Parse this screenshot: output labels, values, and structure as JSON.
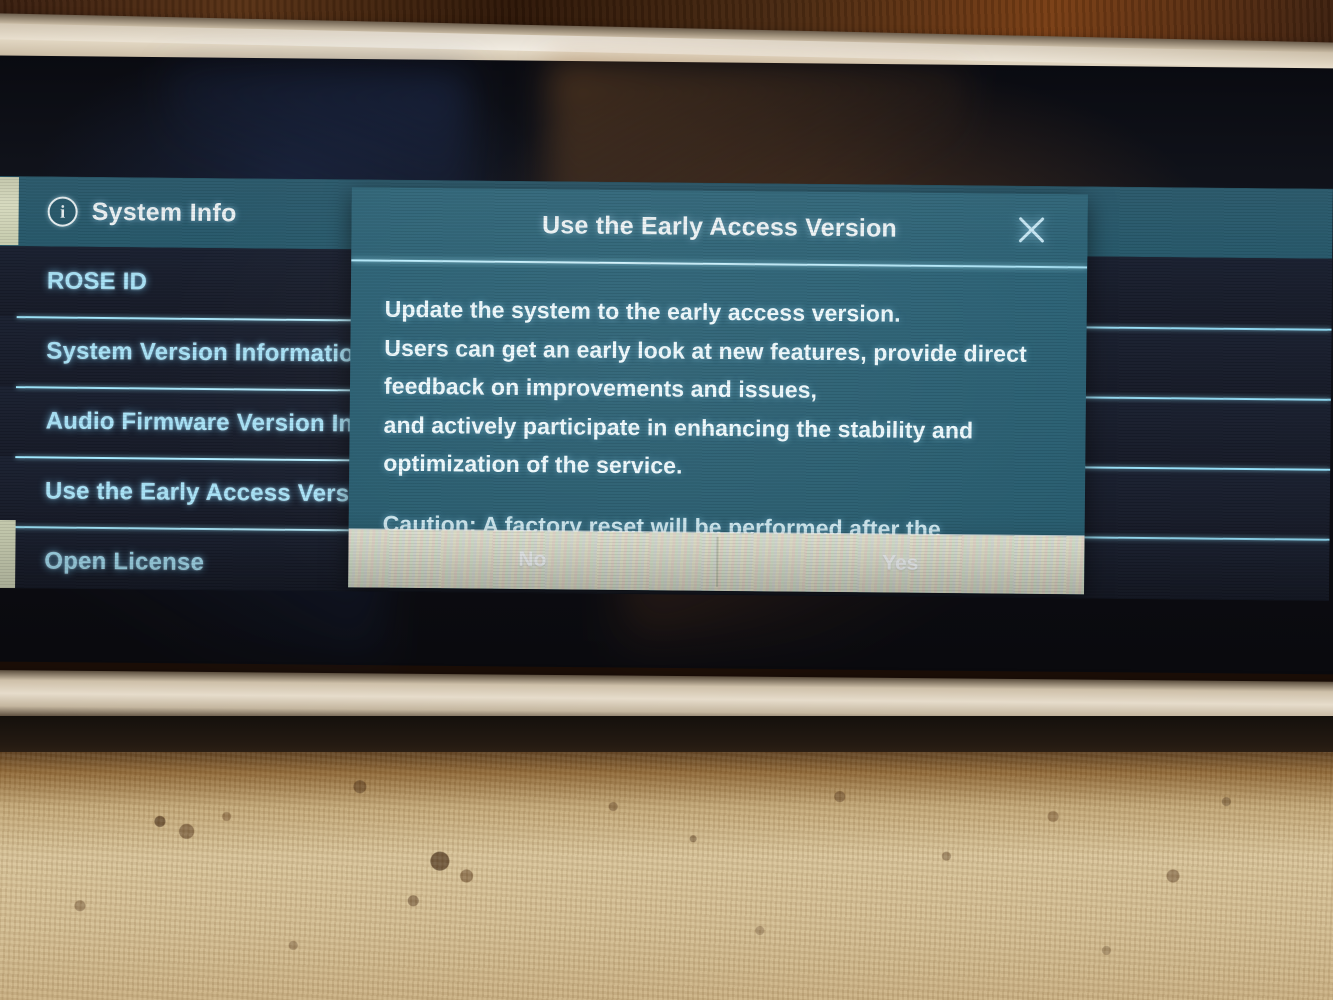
{
  "screen": {
    "header": {
      "icon": "info-circle-icon",
      "title": "System Info"
    },
    "menu_items": [
      {
        "label": "ROSE ID"
      },
      {
        "label": "System Version Information"
      },
      {
        "label": "Audio Firmware Version Information"
      },
      {
        "label": "Use the Early Access Version"
      },
      {
        "label": "Open License"
      }
    ]
  },
  "dialog": {
    "title": "Use the Early Access Version",
    "close_icon": "close-x-icon",
    "body_lines": [
      "Update the system to the early access version.",
      "Users can get an early look at new features, provide direct",
      "feedback on improvements and issues,",
      "and actively participate in enhancing the stability and",
      "optimization of the service."
    ],
    "partial_line": "Caution: A factory reset will be performed after the",
    "buttons": [
      {
        "label": "No"
      },
      {
        "label": "Yes"
      }
    ]
  },
  "colors": {
    "dialog_bg": "#2a6073",
    "header_bg": "#2b5d70",
    "row_bg": "#181d2b",
    "row_text": "#a9e3f7",
    "divider": "#9fe9ff",
    "button_bar": "#dfe2cb"
  }
}
